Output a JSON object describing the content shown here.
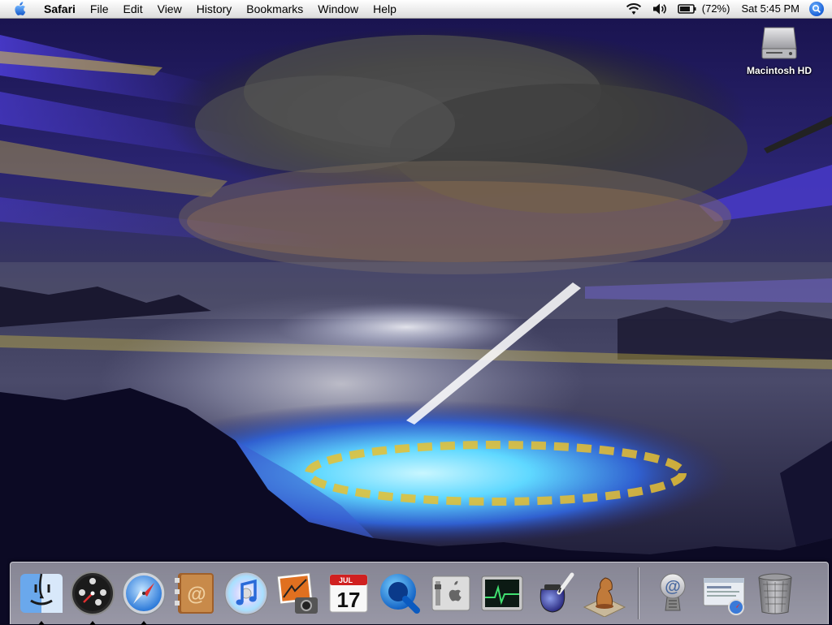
{
  "menubar": {
    "app_name": "Safari",
    "items": [
      "File",
      "Edit",
      "View",
      "History",
      "Bookmarks",
      "Window",
      "Help"
    ],
    "battery_percent": "(72%)",
    "clock": "Sat 5:45 PM"
  },
  "desktop": {
    "icons": [
      {
        "label": "Macintosh HD",
        "icon": "hard-drive-icon"
      }
    ]
  },
  "dock": {
    "apps": [
      {
        "name": "Finder",
        "icon": "finder-icon",
        "running": true
      },
      {
        "name": "Dashboard",
        "icon": "dashboard-icon",
        "running": true
      },
      {
        "name": "Safari",
        "icon": "safari-icon",
        "running": true
      },
      {
        "name": "Address Book",
        "icon": "address-book-icon",
        "running": false
      },
      {
        "name": "iTunes",
        "icon": "itunes-icon",
        "running": false
      },
      {
        "name": "iPhoto",
        "icon": "iphoto-icon",
        "running": false
      },
      {
        "name": "iCal",
        "icon": "ical-icon",
        "running": false
      },
      {
        "name": "QuickTime Player",
        "icon": "quicktime-icon",
        "running": false
      },
      {
        "name": "System Preferences",
        "icon": "system-preferences-icon",
        "running": false
      },
      {
        "name": "Activity Monitor",
        "icon": "activity-monitor-icon",
        "running": false
      },
      {
        "name": "Script Editor",
        "icon": "script-editor-icon",
        "running": false
      },
      {
        "name": "Chess",
        "icon": "chess-icon",
        "running": false
      }
    ],
    "others": [
      {
        "name": "Mail",
        "icon": "mail-icon"
      },
      {
        "name": "Downloads",
        "icon": "downloads-icon"
      },
      {
        "name": "Trash",
        "icon": "trash-icon"
      }
    ],
    "ical_month": "JUL",
    "ical_day": "17"
  },
  "colors": {
    "menubar_bg": "#ececec",
    "wallpaper_sky": "#1b1560",
    "wallpaper_accent_blue": "#4a3bd0",
    "wallpaper_accent_yellow": "#e8d040",
    "lake_cyan": "#5fd8ff",
    "spotlight_blue": "#1a5fd6"
  }
}
